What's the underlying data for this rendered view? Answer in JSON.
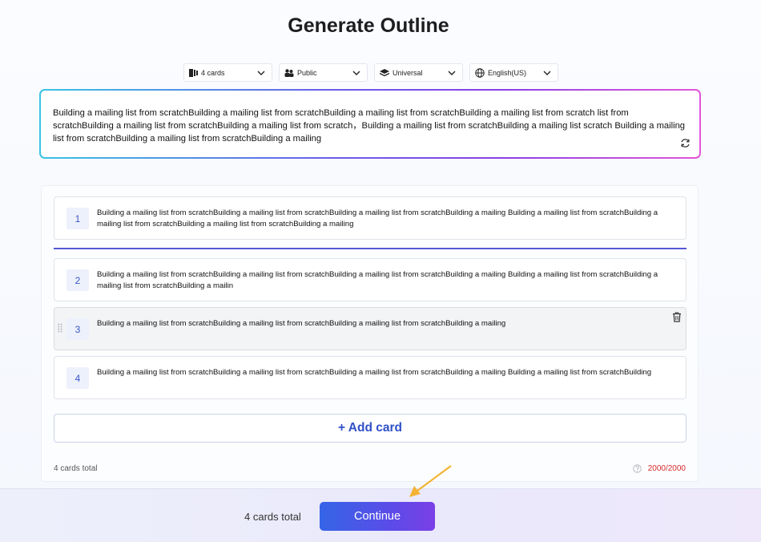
{
  "page": {
    "title": "Generate Outline"
  },
  "selectors": {
    "cards": "4 cards",
    "audience": "Public",
    "theme": "Universal",
    "language": "English(US)"
  },
  "prompt": {
    "text": "Building a mailing list from scratchBuilding a mailing list from scratchBuilding a mailing list from scratchBuilding a mailing list from scratch list from scratchBuilding a mailing list from scratchBuilding a mailing list from scratch，Building a mailing list from scratchBuilding a mailing list scratch Building a mailing list from scratchBuilding a mailing list from scratchBuilding a mailing"
  },
  "outline": {
    "cards": [
      {
        "number": "1",
        "text": "Building a mailing list from scratchBuilding a mailing list from scratchBuilding a mailing list from scratchBuilding a mailing Building a mailing list from scratchBuilding a mailing list from scratchBuilding a mailing list from scratchBuilding a mailing"
      },
      {
        "number": "2",
        "text": "Building a mailing list from scratchBuilding a mailing list from scratchBuilding a mailing list from scratchBuilding a mailing Building a mailing list from scratchBuilding a mailing list from scratchBuilding a mailin"
      },
      {
        "number": "3",
        "text": "Building a mailing list from scratchBuilding a mailing list from scratchBuilding a mailing list from scratchBuilding a mailing"
      },
      {
        "number": "4",
        "text": "Building a mailing list from scratchBuilding a mailing list from scratchBuilding a mailing list from scratchBuilding a mailing Building a mailing list from scratchBuilding"
      }
    ],
    "add_card_label": "+ Add card",
    "total_label": "4 cards total",
    "char_count": "2000/2000"
  },
  "footer": {
    "total_label": "4 cards total",
    "continue_label": "Continue"
  },
  "colors": {
    "accent": "#3565e6",
    "divider": "#5558d8",
    "limit_warning": "#d62b2b",
    "arrow": "#f5b335"
  },
  "icons": [
    "cards-icon",
    "users-icon",
    "layers-icon",
    "globe-icon",
    "chevron-down-icon",
    "refresh-icon",
    "trash-icon",
    "drag-handle-icon",
    "help-circle-icon",
    "arrow-pointer-icon"
  ]
}
